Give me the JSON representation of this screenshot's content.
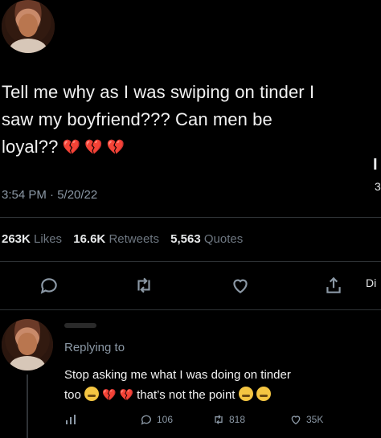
{
  "tweet": {
    "text_line1": "Tell me why as I was swiping on tinder I",
    "text_line2": "saw my boyfriend??? Can men be",
    "text_line3": "loyal??",
    "timestamp": "3:54 PM · 5/20/22"
  },
  "stats": {
    "likes_count": "263K",
    "likes_label": "Likes",
    "retweets_count": "16.6K",
    "retweets_label": "Retweets",
    "quotes_count": "5,563",
    "quotes_label": "Quotes"
  },
  "actions": [
    "reply-icon",
    "retweet-icon",
    "like-icon",
    "share-icon"
  ],
  "reply": {
    "replying_to": "Replying to",
    "text_line1": "Stop asking me what I was doing on tinder",
    "text_line2_a": "too",
    "text_line2_b": "that’s not the point",
    "stats": {
      "replies": "106",
      "retweets": "818",
      "likes": "35K"
    }
  },
  "edge_fragments": {
    "right_top": "3",
    "right_mid": "Di"
  },
  "colors": {
    "background": "#000000",
    "text": "#e7e9ea",
    "muted": "#8b98a5",
    "heart": "#e0245e"
  }
}
